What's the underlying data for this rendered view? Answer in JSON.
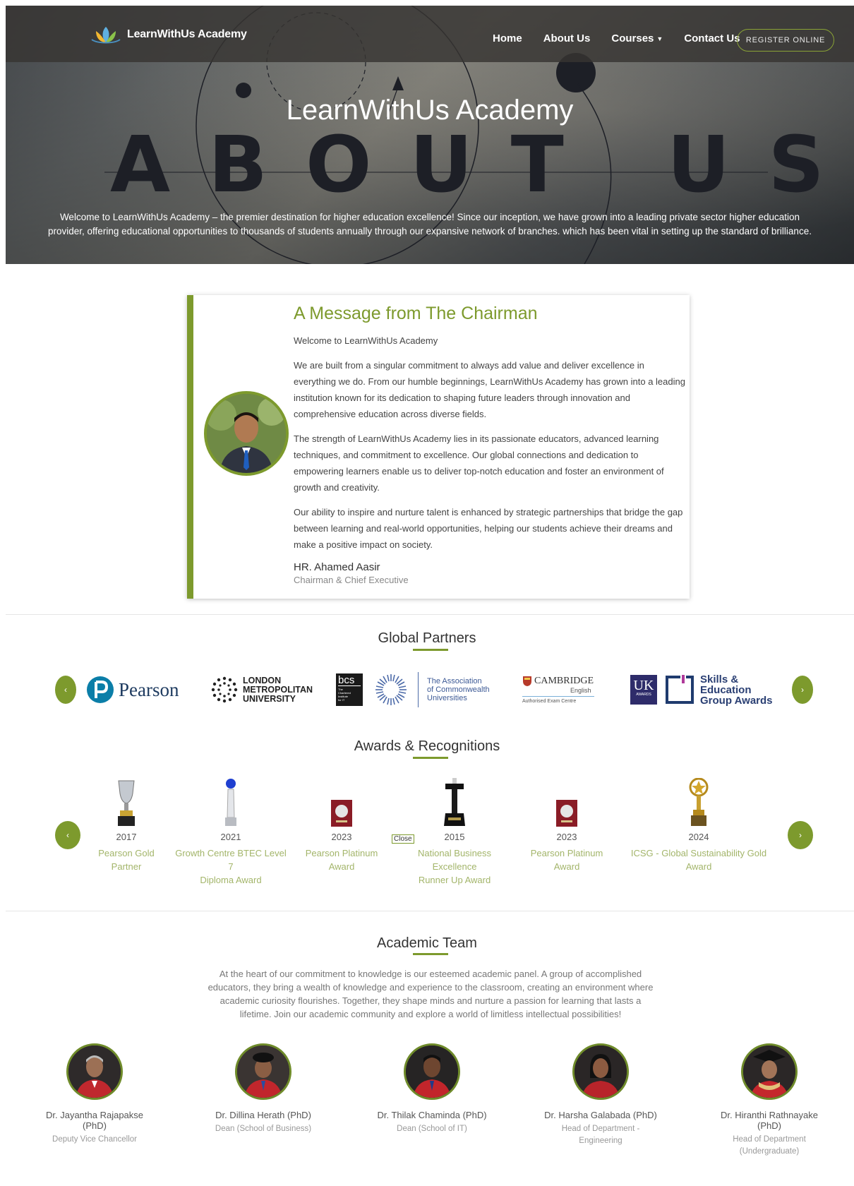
{
  "nav": {
    "brand": "LearnWithUs Academy",
    "links": [
      "Home",
      "About Us",
      "Courses",
      "Contact Us"
    ],
    "register": "REGISTER ONLINE"
  },
  "hero": {
    "title": "LearnWithUs Academy",
    "big_text": "ABOUT US",
    "description": "Welcome to LearnWithUs Academy – the premier destination for higher education excellence! Since our inception, we have grown into a leading private sector higher education provider, offering educational opportunities to thousands of students annually through our expansive network of branches. which has been vital in setting up the standard of brilliance."
  },
  "chairman": {
    "title": "A Message from The Chairman",
    "greeting": "Welcome to LearnWithUs Academy",
    "paragraphs": [
      "We are built from a singular commitment to always add value and deliver excellence in everything we do. From our humble beginnings, LearnWithUs Academy has grown into a leading institution known for its dedication to shaping future leaders through innovation and comprehensive education across diverse fields.",
      "The strength of LearnWithUs Academy lies in its passionate educators, advanced learning techniques, and commitment to excellence. Our global connections and dedication to empowering learners enable us to deliver top-notch education and foster an environment of growth and creativity.",
      "Our ability to inspire and nurture talent is enhanced by strategic partnerships that bridge the gap between learning and real-world opportunities, helping our students achieve their dreams and make a positive impact on society."
    ],
    "name": "HR. Ahamed Aasir",
    "role": "Chairman & Chief Executive"
  },
  "partners": {
    "title": "Global Partners",
    "prev": "‹",
    "next": "›",
    "pearson": "Pearson",
    "london": [
      "LONDON",
      "METROPOLITAN",
      "UNIVERSITY"
    ],
    "bcs": "bcs",
    "bcs_sub": [
      "The",
      "Chartered",
      "Institute",
      "for IT"
    ],
    "acu": [
      "The Association",
      "of Commonwealth",
      "Universities"
    ],
    "cambridge": "CAMBRIDGE",
    "cambridge_sub": "English",
    "cambridge_note": "Authorised Exam Centre",
    "uk": "UK",
    "uk_sub": "AWARDS",
    "skills": [
      "Skills &",
      "Education",
      "Group Awards"
    ]
  },
  "awards": {
    "title": "Awards & Recognitions",
    "prev": "‹",
    "next": "›",
    "close_label": "Close",
    "items": [
      {
        "year": "2017",
        "name": "Pearson Gold\nPartner",
        "icon": "trophy-cup-icon"
      },
      {
        "year": "2021",
        "name": "Growth Centre BTEC Level\n7\nDiploma Award",
        "icon": "crystal-trophy-icon"
      },
      {
        "year": "2023",
        "name": "Pearson Platinum\nAward",
        "icon": "plaque-icon"
      },
      {
        "year": "2015",
        "name": "National Business\nExcellence\nRunner Up Award",
        "icon": "pillar-trophy-icon"
      },
      {
        "year": "2023",
        "name": "Pearson Platinum\nAward",
        "icon": "plaque-icon"
      },
      {
        "year": "2024",
        "name": "ICSG - Global Sustainability Gold\nAward",
        "icon": "star-trophy-icon"
      }
    ]
  },
  "team": {
    "title": "Academic Team",
    "intro": "At the heart of our commitment to knowledge is our esteemed academic panel. A group of accomplished educators, they bring a wealth of knowledge and experience to the classroom, creating an environment where academic curiosity flourishes. Together, they shape minds and nurture a passion for learning that lasts a lifetime. Join our academic community and explore a world of limitless intellectual possibilities!",
    "members": [
      {
        "name": "Dr. Jayantha Rajapakse\n(PhD)",
        "role": "Deputy Vice Chancellor"
      },
      {
        "name": "Dr. Dillina Herath (PhD)",
        "role": "Dean (School of Business)"
      },
      {
        "name": "Dr. Thilak Chaminda (PhD)",
        "role": "Dean (School of IT)"
      },
      {
        "name": "Dr. Harsha Galabada (PhD)",
        "role": "Head of Department -\nEngineering"
      },
      {
        "name": "Dr. Hiranthi Rathnayake\n(PhD)",
        "role": "Head of Department\n(Undergraduate)"
      }
    ]
  },
  "colors": {
    "accent": "#7d9a2d",
    "award_text": "#a3b56a",
    "hero_letters": "#1d1f26"
  }
}
